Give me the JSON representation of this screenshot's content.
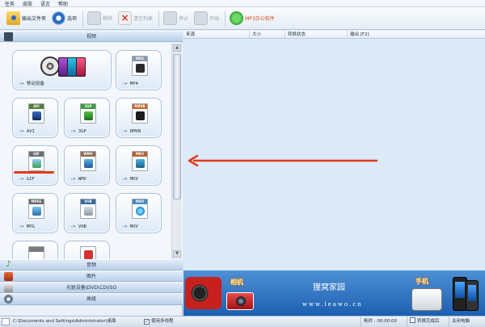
{
  "menubar": {
    "items": [
      "任务",
      "皮肤",
      "语言",
      "帮助"
    ]
  },
  "toolbar": {
    "output_folder": "输出文件夹",
    "options": "选项",
    "remove": "移除",
    "clear_list": "清空列表",
    "stop": "停止",
    "start": "开始",
    "office": "MP3办公软件"
  },
  "left": {
    "video_header": "视频",
    "audio_header": "音频",
    "image_header": "图片",
    "disc_header": "光驱设备\\DVD\\CD\\ISO",
    "advanced_header": "高级",
    "formats": [
      {
        "label": "-> 移动设备",
        "tag": ""
      },
      {
        "label": "-> MP4",
        "tag": "MP4"
      },
      {
        "label": "-> AVI",
        "tag": "AVI"
      },
      {
        "label": "-> 3GP",
        "tag": "3GP"
      },
      {
        "label": "-> RMVB",
        "tag": "RMVB"
      },
      {
        "label": "-> GIF",
        "tag": "GIF"
      },
      {
        "label": "-> WMV",
        "tag": "WMV"
      },
      {
        "label": "-> MKV",
        "tag": "MKV"
      },
      {
        "label": "-> MPG",
        "tag": "MPEG"
      },
      {
        "label": "-> VOB",
        "tag": "VOB"
      },
      {
        "label": "-> MOV",
        "tag": "MOV"
      }
    ]
  },
  "list": {
    "columns": [
      "来源",
      "大小",
      "转换状态",
      "输出 [F2]"
    ]
  },
  "banner": {
    "camera_badge": "相机",
    "phone_badge": "手机",
    "brand": "狸窝家园",
    "url": "www.leawo.cn"
  },
  "status": {
    "path": "C:\\Documents and Settings\\Administrator\\桌面",
    "multithread": "使用多线程",
    "elapsed": "耗时 : 00:00:00",
    "after_convert": "转换完成后",
    "shutdown": "关闭电脑"
  },
  "colors": {
    "accent_arrow": "#e23a1c",
    "brand_blue": "#1c5fb0"
  }
}
